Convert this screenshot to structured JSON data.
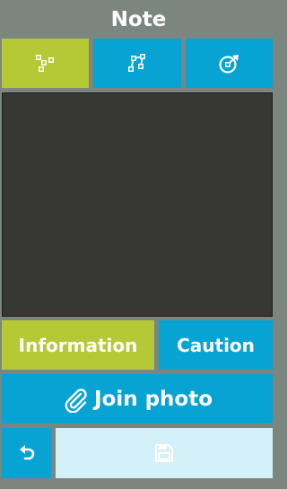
{
  "header": {
    "title": "Note"
  },
  "modes": [
    {
      "icon": "point-markers-icon",
      "active": true
    },
    {
      "icon": "polyline-draw-icon",
      "active": false
    },
    {
      "icon": "target-arrow-icon",
      "active": false
    }
  ],
  "note_types": [
    {
      "label": "Information",
      "active": true
    },
    {
      "label": "Caution",
      "active": false
    }
  ],
  "actions": {
    "join_photo_label": "Join photo",
    "join_photo_icon": "paperclip-icon",
    "undo_icon": "undo-icon",
    "save_icon": "floppy-disk-icon",
    "save_enabled": false
  },
  "colors": {
    "background": "#7c8680",
    "accent_green": "#b4c935",
    "accent_blue": "#06a3d3",
    "disabled_blue": "#d4f1fa",
    "canvas": "#373735"
  }
}
